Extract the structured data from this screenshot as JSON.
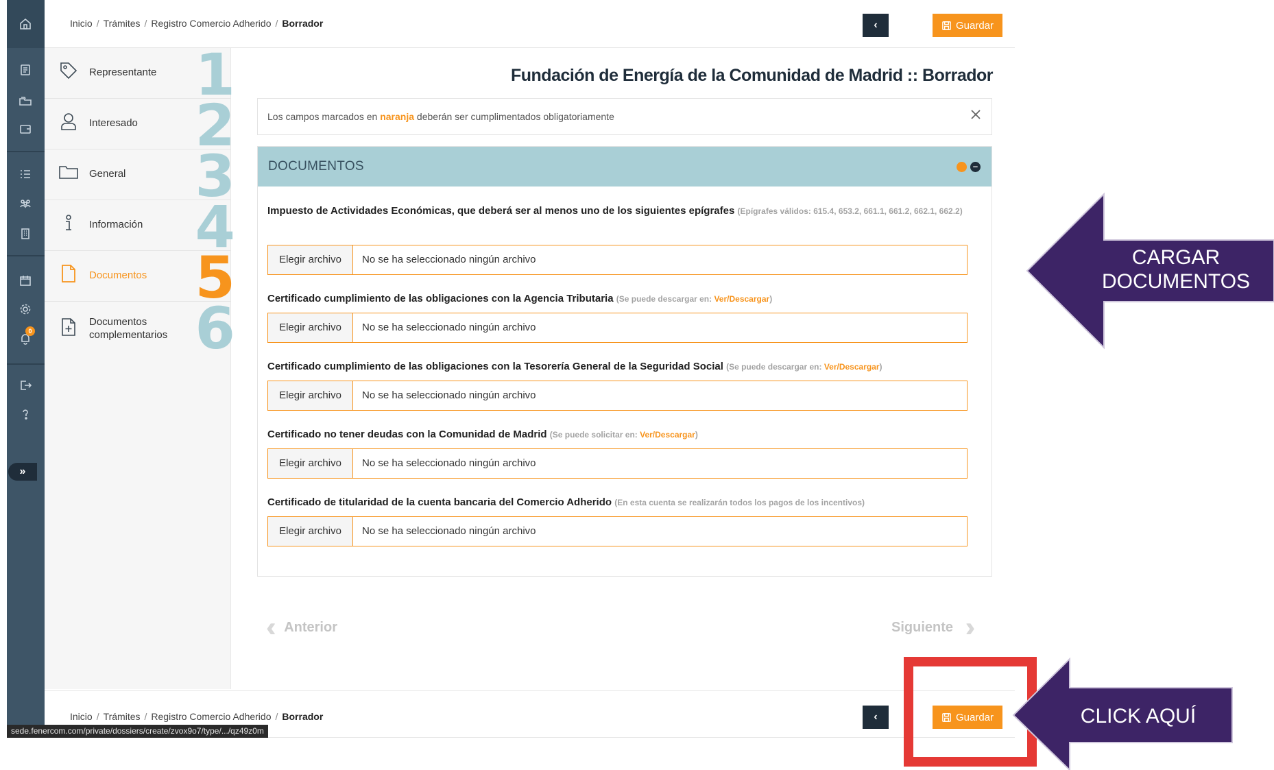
{
  "breadcrumb": [
    "Inicio",
    "Trámites",
    "Registro Comercio Adherido",
    "Borrador"
  ],
  "buttons": {
    "save": "Guardar",
    "back": "‹"
  },
  "title": "Fundación de Energía de la Comunidad de Madrid :: Borrador",
  "notice": {
    "prefix": "Los campos marcados en ",
    "highlight": "naranja",
    "suffix": " deberán ser cumplimentados obligatoriamente"
  },
  "steps": [
    {
      "num": "1",
      "label": "Representante",
      "icon": "tag-icon"
    },
    {
      "num": "2",
      "label": "Interesado",
      "icon": "user-icon"
    },
    {
      "num": "3",
      "label": "General",
      "icon": "folder-icon"
    },
    {
      "num": "4",
      "label": "Información",
      "icon": "info-icon"
    },
    {
      "num": "5",
      "label": "Documentos",
      "icon": "document-icon",
      "active": true
    },
    {
      "num": "6",
      "label": "Documentos complementarios",
      "icon": "document-add-icon"
    }
  ],
  "panel": {
    "title": "DOCUMENTOS"
  },
  "file": {
    "button": "Elegir archivo",
    "empty": "No se ha seleccionado ningún archivo"
  },
  "documents": [
    {
      "label": "Impuesto de Actividades Económicas, que deberá ser al menos uno de los siguientes epígrafes",
      "hint": "(Epígrafes válidos: 615.4, 653.2, 661.1, 661.2, 662.1, 662.2)",
      "link": ""
    },
    {
      "label": "Certificado cumplimiento de las obligaciones con la Agencia Tributaria",
      "hint": "(Se puede descargar en: ",
      "link": "Ver/Descargar",
      "hint_end": ")"
    },
    {
      "label": "Certificado cumplimiento de las obligaciones con la Tesorería General de la Seguridad Social",
      "hint": "(Se puede descargar en: ",
      "link": "Ver/Descargar",
      "hint_end": ")"
    },
    {
      "label": "Certificado no tener deudas con la Comunidad de Madrid",
      "hint": "(Se puede solicitar en: ",
      "link": "Ver/Descargar",
      "hint_end": ")"
    },
    {
      "label": "Certificado de titularidad de la cuenta bancaria del Comercio Adherido",
      "hint": "(En esta cuenta se realizarán todos los pagos de los incentivos)",
      "link": ""
    }
  ],
  "nav": {
    "prev": "Anterior",
    "next": "Siguiente"
  },
  "status_url": "sede.fenercom.com/private/dossiers/create/zvox9o7/type/.../qz49z0m",
  "notification_count": "0",
  "annotations": {
    "upload": [
      "CARGAR",
      "DOCUMENTOS"
    ],
    "click": "CLICK AQUÍ"
  },
  "colors": {
    "accent": "#f7941d",
    "dark": "#1f2d3a",
    "panel_head": "#a9cfd6",
    "arrow": "#3d2466",
    "highlight_box": "#e53935"
  }
}
